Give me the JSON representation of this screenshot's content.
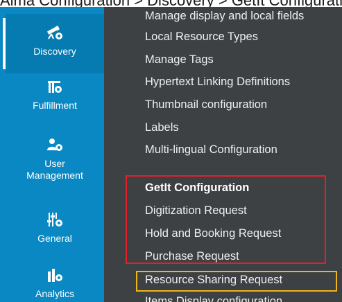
{
  "breadcrumb": "Alma Configuration > Discovery > GetIt Configuration",
  "sidebar": {
    "items": [
      {
        "label": "Discovery",
        "icon": "telescope-gear-icon",
        "active": true
      },
      {
        "label": "Fulfillment",
        "icon": "books-gear-icon",
        "active": false
      },
      {
        "label": "User\nManagement",
        "icon": "user-gear-icon",
        "active": false
      },
      {
        "label": "General",
        "icon": "sliders-gear-icon",
        "active": false
      },
      {
        "label": "Analytics",
        "icon": "chart-gear-icon",
        "active": false
      }
    ]
  },
  "menu": {
    "items": [
      "Manage display and local fields",
      "Local Resource Types",
      "Manage Tags",
      "Hypertext Linking Definitions",
      "Thumbnail configuration",
      "Labels",
      "Multi-lingual Configuration"
    ],
    "section_heading": "GetIt Configuration",
    "section_items": [
      "Digitization Request",
      "Hold and Booking Request",
      "Purchase Request",
      "Resource Sharing Request",
      "Items Display configuration"
    ]
  },
  "colors": {
    "sidebar_bg": "#0a88c3",
    "panel_bg": "#3e4143",
    "highlight_red": "#e0212b",
    "highlight_yellow": "#f1b519"
  }
}
